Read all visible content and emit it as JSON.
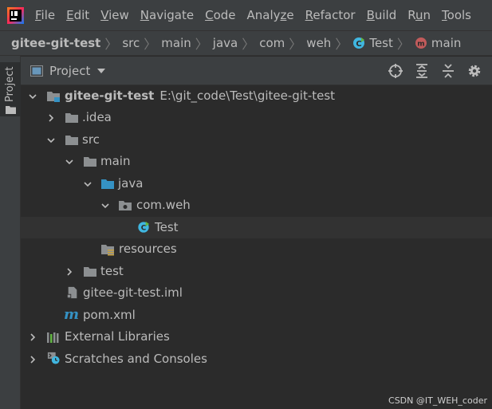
{
  "menubar": {
    "items": [
      {
        "pre": "",
        "mn": "F",
        "post": "ile"
      },
      {
        "pre": "",
        "mn": "E",
        "post": "dit"
      },
      {
        "pre": "",
        "mn": "V",
        "post": "iew"
      },
      {
        "pre": "",
        "mn": "N",
        "post": "avigate"
      },
      {
        "pre": "",
        "mn": "C",
        "post": "ode"
      },
      {
        "pre": "Analy",
        "mn": "z",
        "post": "e"
      },
      {
        "pre": "",
        "mn": "R",
        "post": "efactor"
      },
      {
        "pre": "",
        "mn": "B",
        "post": "uild"
      },
      {
        "pre": "R",
        "mn": "u",
        "post": "n"
      },
      {
        "pre": "",
        "mn": "T",
        "post": "ools"
      }
    ]
  },
  "breadcrumb": {
    "items": [
      "gitee-git-test",
      "src",
      "main",
      "java",
      "com",
      "weh",
      "Test",
      "main"
    ]
  },
  "sidebar": {
    "tab_label": "Project"
  },
  "toolwindow": {
    "title": "Project"
  },
  "tree": {
    "root_name": "gitee-git-test",
    "root_path": "E:\\git_code\\Test\\gitee-git-test",
    "idea": ".idea",
    "src": "src",
    "main": "main",
    "java": "java",
    "package": "com.weh",
    "test_class": "Test",
    "resources": "resources",
    "test": "test",
    "iml": "gitee-git-test.iml",
    "pom": "pom.xml",
    "external_libraries": "External Libraries",
    "scratches": "Scratches and Consoles"
  },
  "colors": {
    "background": "#2b2b2b",
    "panel": "#3c3f41",
    "folder": "#8c8f91",
    "source_folder": "#3592c4",
    "class_icon": "#40b6e0",
    "method_icon": "#c15b5b",
    "selected_row": "#323232"
  },
  "watermark": "CSDN @IT_WEH_coder"
}
